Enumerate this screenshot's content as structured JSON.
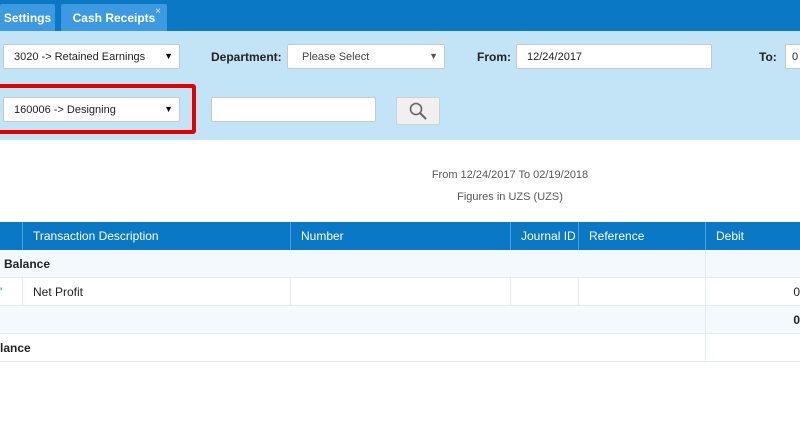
{
  "tabs": [
    {
      "label": "Settings"
    },
    {
      "label": "Cash Receipts",
      "close": "×"
    }
  ],
  "filters": {
    "account_value": "3020 -> Retained Earnings",
    "department_label": "Department:",
    "department_value": "Please Select",
    "from_label": "From:",
    "from_value": "12/24/2017",
    "to_label": "To:",
    "to_value": "0",
    "item_value": "160006 -> Designing",
    "search_value": ""
  },
  "report": {
    "range_text": "From 12/24/2017 To 02/19/2018",
    "figures_text": "Figures in UZS (UZS)"
  },
  "table": {
    "columns": [
      "Transaction Description",
      "Number",
      "Journal ID",
      "Reference",
      "Debit"
    ],
    "rows": [
      {
        "first": "Balance",
        "desc": "",
        "debit": ""
      },
      {
        "first": "'",
        "desc": "Net Profit",
        "debit": "0"
      },
      {
        "first": "",
        "desc": "",
        "debit": "0"
      },
      {
        "first": "lance",
        "desc": "",
        "debit": ""
      }
    ]
  },
  "colors": {
    "tabbar": "#0a78c4",
    "panel": "#c3e4f7",
    "highlight": "#e00000"
  }
}
